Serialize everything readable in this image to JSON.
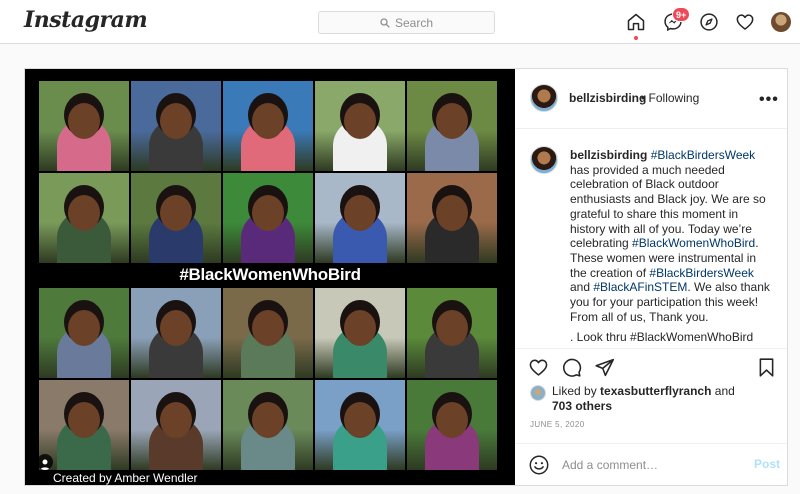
{
  "nav": {
    "logo": "Instagram",
    "search_placeholder": "Search",
    "notification_badge": "9+",
    "icons": [
      "home-icon",
      "messenger-icon",
      "explore-icon",
      "heart-icon"
    ]
  },
  "photo": {
    "hashtag": "#BlackWomenWhoBird",
    "credit": "Created by Amber Wendler",
    "tile_colors_top": [
      "#6a8d4e",
      "#4a6a9c",
      "#3b7ab8",
      "#8aa86a",
      "#6d8a44",
      "#7a9a5a",
      "#5c7a3f",
      "#3d8a3a",
      "#a8b8c8",
      "#9a6a4a"
    ],
    "tile_colors_bottom": [
      "#4e7a3c",
      "#8aa0b8",
      "#7a6a4a",
      "#c8c8b8",
      "#5a8a3a",
      "#8a7a6a",
      "#9aa6b8",
      "#6a8a5a",
      "#7aa0c8",
      "#4a7a3a"
    ]
  },
  "post": {
    "username": "bellzisbirding",
    "separator": "•",
    "follow_state": "Following",
    "caption": {
      "user": "bellzisbirding",
      "parts": [
        {
          "t": "tag",
          "v": "#BlackBirdersWeek"
        },
        {
          "t": "text",
          "v": " has provided a much needed celebration of Black outdoor enthusiasts and Black joy. We are so grateful to share this moment in history with all of you. Today we’re celebrating "
        },
        {
          "t": "tag",
          "v": "#BlackWomenWhoBird"
        },
        {
          "t": "text",
          "v": ". These women were instrumental in the creation of "
        },
        {
          "t": "tag",
          "v": "#BlackBirdersWeek"
        },
        {
          "t": "text",
          "v": " and "
        },
        {
          "t": "tag",
          "v": "#BlackAFinSTEM"
        },
        {
          "t": "text",
          "v": ". We also thank you for your participation this week! From all of us, Thank you."
        }
      ],
      "extra": ". Look thru #BlackWomenWhoBird to..."
    },
    "likes_prefix": "Liked by",
    "likes_user": "texasbutterflyranch",
    "likes_suffix": "and",
    "likes_others": "703 others",
    "date": "JUNE 5, 2020",
    "comment_placeholder": "Add a comment…",
    "post_button": "Post"
  }
}
